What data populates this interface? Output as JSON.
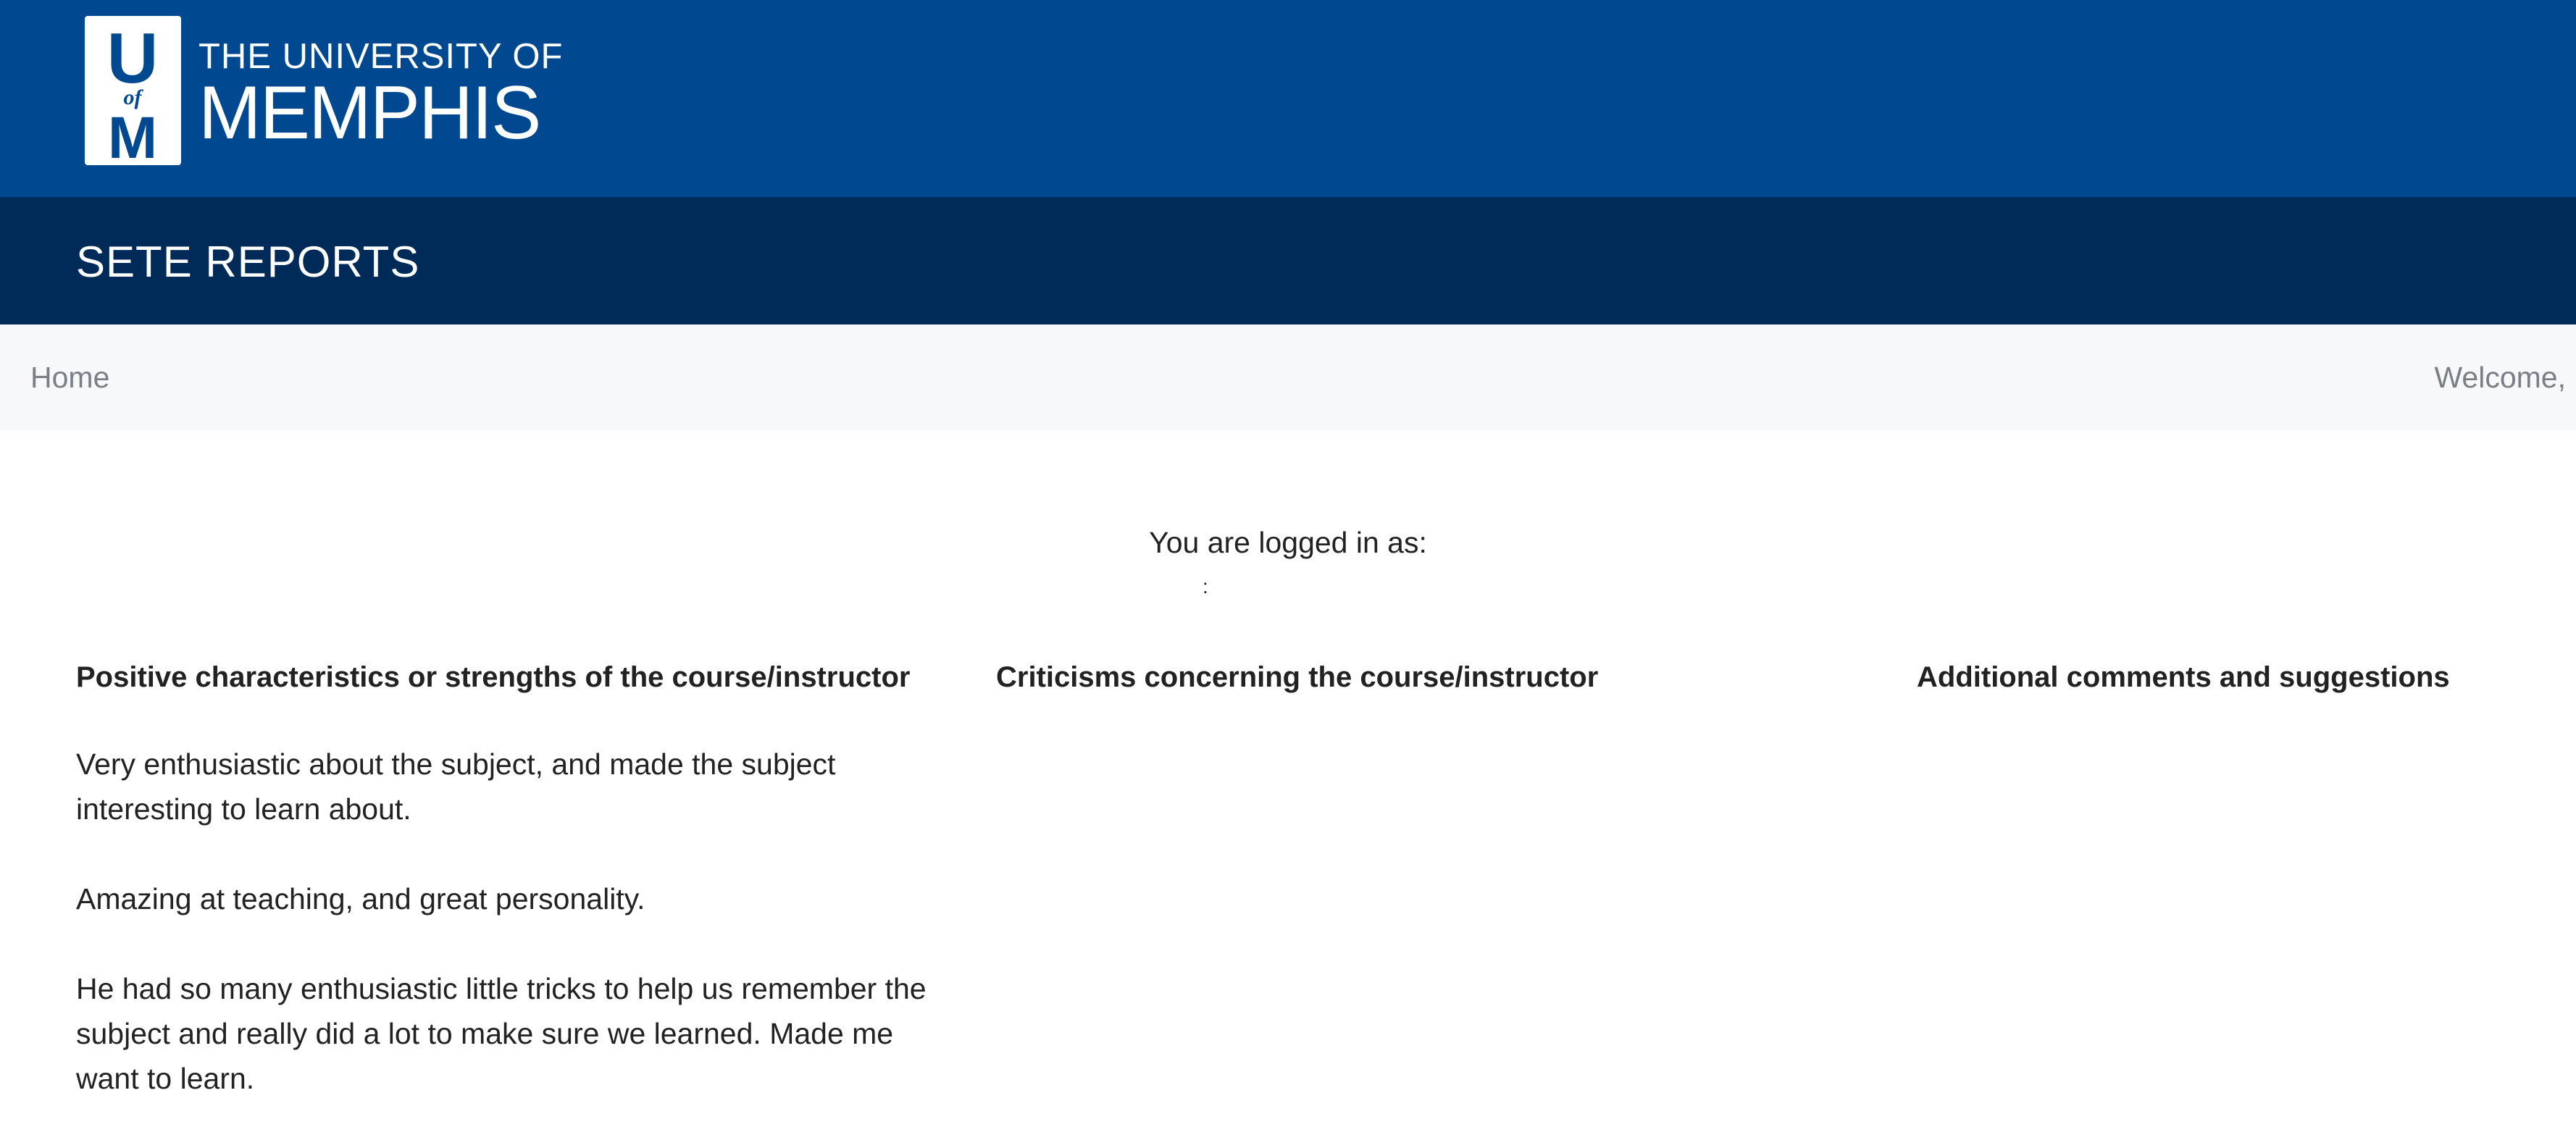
{
  "header": {
    "logo": {
      "mark_top": "U",
      "mark_middle": "of",
      "mark_bottom": "M",
      "line1": "THE UNIVERSITY OF",
      "line2": "MEMPHIS"
    },
    "app_title": "SETE REPORTS"
  },
  "nav": {
    "home_label": "Home",
    "welcome_text": "Welcome,"
  },
  "login": {
    "label": "You are logged in as:",
    "user": ":"
  },
  "columns": [
    {
      "heading": "Positive characteristics or strengths of the course/instructor",
      "comments": [
        "Very enthusiastic about the subject, and made the subject interesting to learn about.",
        "Amazing at teaching, and great personality.",
        "He had so many enthusiastic little tricks to help us remember the subject and really did a lot to make sure we learned. Made me want to learn."
      ]
    },
    {
      "heading": "Criticisms concerning the course/instructor",
      "comments": []
    },
    {
      "heading": "Additional comments and suggestions",
      "comments": []
    }
  ],
  "colors": {
    "brand_blue": "#004990",
    "brand_navy": "#002b58",
    "nav_background": "#f7f8fa",
    "nav_text": "#7a7f85",
    "body_text": "#222222"
  }
}
